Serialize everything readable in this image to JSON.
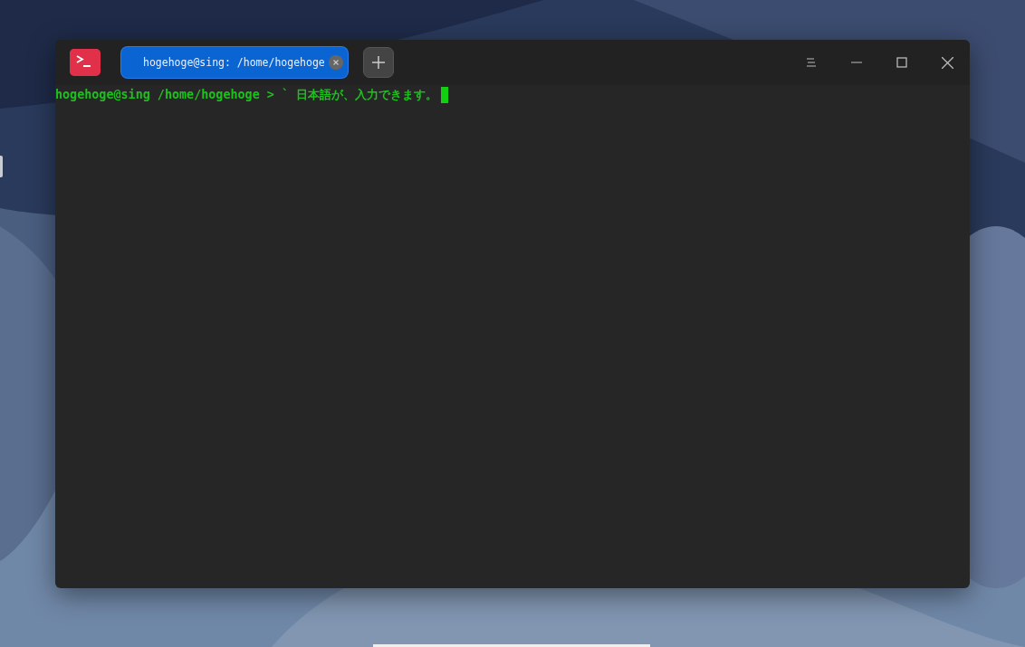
{
  "window": {
    "tabs": [
      {
        "label": "hogehoge@sing: /home/hogehoge",
        "selected": true
      }
    ]
  },
  "terminal": {
    "lines": [
      "hogehoge@sing /home/hogehoge > ` 日本語が、入力できます。"
    ],
    "cursor_visible": true
  }
}
